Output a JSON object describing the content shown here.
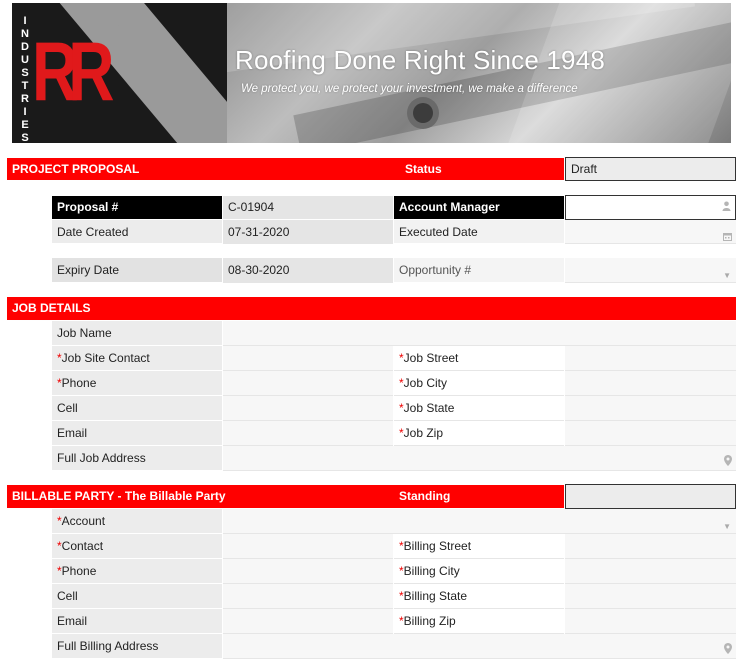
{
  "banner": {
    "logo_vertical_text": "INDUSTRIES",
    "logo_letters": "RR",
    "tagline": "Roofing Done Right Since 1948",
    "subtagline": "We protect you, we protect your investment, we make a difference"
  },
  "proposal": {
    "section_title": "PROJECT PROPOSAL",
    "status_label": "Status",
    "status_value": "Draft",
    "proposal_no_label": "Proposal #",
    "proposal_no_value": "C-01904",
    "account_manager_label": "Account Manager",
    "account_manager_value": "",
    "date_created_label": "Date Created",
    "date_created_value": "07-31-2020",
    "executed_date_label": "Executed Date",
    "executed_date_value": "",
    "expiry_date_label": "Expiry Date",
    "expiry_date_value": "08-30-2020",
    "opportunity_label": "Opportunity #",
    "opportunity_value": ""
  },
  "job": {
    "section_title": "JOB DETAILS",
    "job_name_label": "Job Name",
    "job_site_contact_label": "Job Site Contact",
    "phone_label": "Phone",
    "cell_label": "Cell",
    "email_label": "Email",
    "full_address_label": "Full Job Address",
    "street_label": "Job Street",
    "city_label": "Job City",
    "state_label": "Job State",
    "zip_label": "Job Zip",
    "required_mark": "*"
  },
  "billing": {
    "section_title": "BILLABLE PARTY - The Billable Party",
    "standing_label": "Standing",
    "standing_value": "",
    "account_label": "Account",
    "contact_label": "Contact",
    "phone_label": "Phone",
    "cell_label": "Cell",
    "email_label": "Email",
    "full_address_label": "Full Billing Address",
    "street_label": "Billing Street",
    "city_label": "Billing City",
    "state_label": "Billing State",
    "zip_label": "Billing Zip",
    "required_mark": "*"
  },
  "icons": {
    "person": "person-icon",
    "calendar": "calendar-icon",
    "dropdown": "chevron-down-icon",
    "location": "location-pin-icon"
  }
}
